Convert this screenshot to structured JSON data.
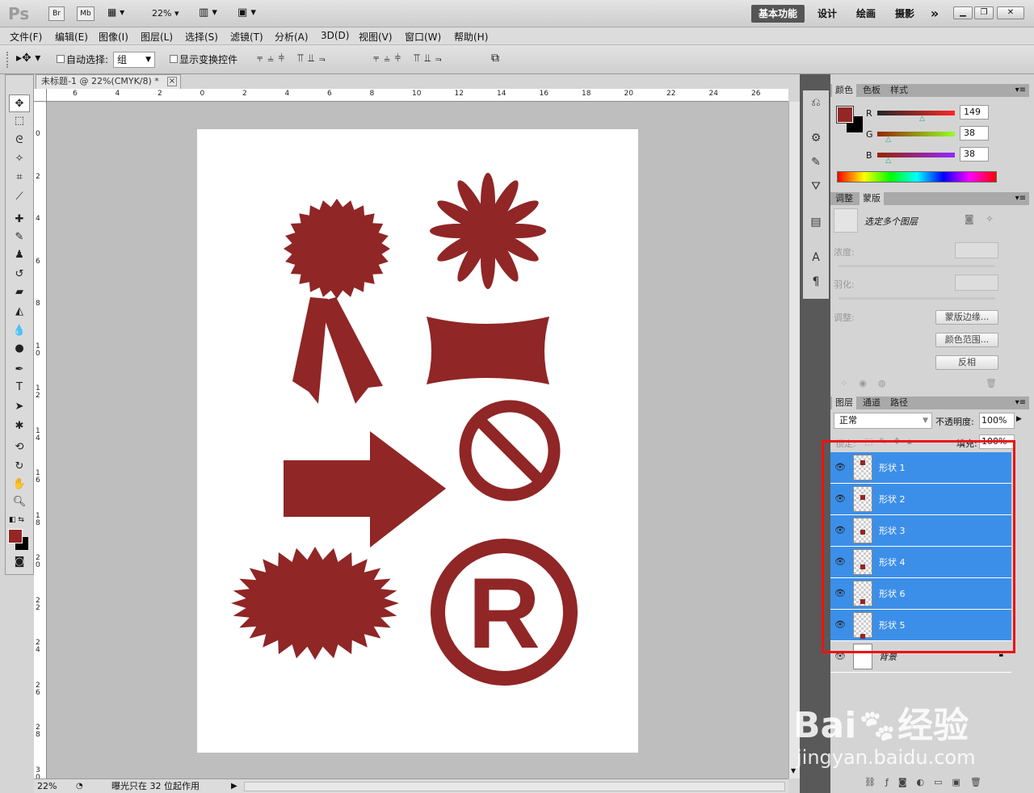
{
  "appbar": {
    "logo": "Ps",
    "br": "Br",
    "mb": "Mb",
    "zoom": "22%",
    "workspaces": [
      "基本功能",
      "设计",
      "绘画",
      "摄影"
    ],
    "more": "»"
  },
  "menu": [
    "文件(F)",
    "编辑(E)",
    "图像(I)",
    "图层(L)",
    "选择(S)",
    "滤镜(T)",
    "分析(A)",
    "3D(D)",
    "视图(V)",
    "窗口(W)",
    "帮助(H)"
  ],
  "options": {
    "auto_select_label": "自动选择:",
    "auto_select_value": "组",
    "show_transform_label": "显示变换控件"
  },
  "document": {
    "tab_title": "未标题-1 @ 22%(CMYK/8) *",
    "close": "×",
    "ruler_top": [
      "6",
      "4",
      "2",
      "0",
      "2",
      "4",
      "6",
      "8",
      "10",
      "12",
      "14",
      "16",
      "18",
      "20",
      "22",
      "24",
      "26"
    ],
    "ruler_left": [
      "0",
      "2",
      "4",
      "6",
      "8",
      "10",
      "12",
      "14",
      "16",
      "18",
      "20",
      "22",
      "24",
      "26",
      "28",
      "30"
    ]
  },
  "status": {
    "zoom": "22%",
    "info": "曝光只在 32 位起作用"
  },
  "color_panel": {
    "tabs": [
      "颜色",
      "色板",
      "样式"
    ],
    "r_label": "R",
    "g_label": "G",
    "b_label": "B",
    "r": "149",
    "g": "38",
    "b": "38",
    "r_frac": 0.584,
    "g_frac": 0.149,
    "b_frac": 0.149,
    "fg_color": "#952626"
  },
  "mask_panel": {
    "tabs": [
      "调整",
      "蒙版"
    ],
    "title": "选定多个图层",
    "density": "浓度:",
    "feather": "羽化:",
    "adjust": "调整:",
    "btn_edge": "蒙版边缘...",
    "btn_range": "颜色范围...",
    "btn_invert": "反相"
  },
  "layers_panel": {
    "tabs": [
      "图层",
      "通道",
      "路径"
    ],
    "blend": "正常",
    "opacity_label": "不透明度:",
    "opacity": "100%",
    "lock_label": "锁定:",
    "fill_label": "填充:",
    "fill": "100%",
    "layers": [
      {
        "name": "形状 1",
        "selected": true
      },
      {
        "name": "形状 2",
        "selected": true
      },
      {
        "name": "形状 3",
        "selected": true
      },
      {
        "name": "形状 4",
        "selected": true
      },
      {
        "name": "形状 6",
        "selected": true
      },
      {
        "name": "形状 5",
        "selected": true
      },
      {
        "name": "背景",
        "selected": false
      }
    ]
  },
  "watermark": {
    "brand_left": "Bai",
    "brand_right": "经验",
    "url": "jingyan.baidu.com"
  },
  "colors": {
    "shape": "#902626",
    "selection": "#3c8fe8",
    "highlight": "#ee1111"
  }
}
